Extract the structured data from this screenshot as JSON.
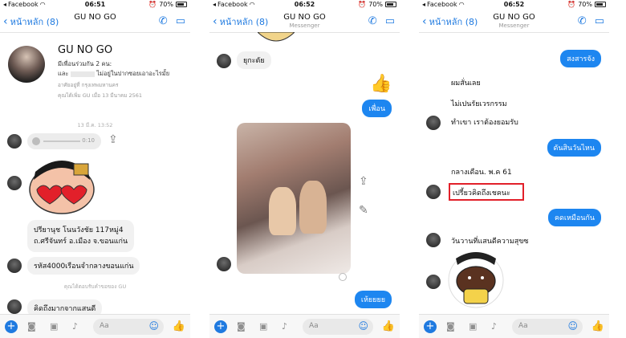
{
  "status": {
    "carrier": "Facebook",
    "battery": "70%",
    "times": [
      "06:51",
      "06:52",
      "06:52"
    ]
  },
  "nav": {
    "back_label": "หน้าหลัก (8)",
    "title": "GU NO GO",
    "subtitle": "Messenger"
  },
  "icons": {
    "phone": "phone-icon",
    "video": "video-camera-icon",
    "camera": "camera-icon",
    "photo": "photo-icon",
    "mic": "microphone-icon",
    "smile": "emoji-icon",
    "like": "thumbs-up-icon",
    "share": "share-icon",
    "edit": "edit-pencil-icon",
    "plus": "plus-icon"
  },
  "colors": {
    "accent": "#1f7ae0",
    "bubble_blue": "#1d86f0",
    "highlight_red": "#e2202a"
  },
  "composer": {
    "placeholder": "Aa"
  },
  "panel1": {
    "profile_name": "GU NO GO",
    "friends_line": "มีเพื่อนร่วมกัน 2 คน:",
    "mutual_line": "และ",
    "mutual_line_b": "ไม่อยู่ในปากซอยเอาอะไรมั้ย",
    "location": "อาศัยอยู่ที่ กรุงเทพมหานคร",
    "added_info": "คุณได้เพิ่ม GU เมื่อ 13 มีนาคม 2561",
    "timestamp": "13 มี.ค. 13:52",
    "audio_duration": "0:10",
    "address_line1": "ปรียานุช  โนนวังชัย 117หมู่4",
    "address_line2": "ถ.ศรีจันทร์ อ.เมือง จ.ขอนแก่น",
    "code_line": "รหัส4000เรือนจำกลางขอนแก่น",
    "system_note": "คุณได้ตอบรับคำขอของ GU",
    "last_message": "คิดถึงมากจากแสนดี"
  },
  "panel2": {
    "msg1": "ยุกะตัย",
    "reply1": "เพื่อน",
    "reply2": "เห้ยยยย"
  },
  "panel3": {
    "blue1": "สงสารจัง",
    "gray1": "ผมสั่นเลย",
    "gray2": "ไม่เปนรัยเวรกรรม",
    "gray3": "ทำเขา เราต้องยอมรับ",
    "blue2": "ดันสินวันไหน",
    "gray4": "กลางเดือน. พ.ค 61",
    "gray5": "เปรี้ยวคิดถึงเชคนะ",
    "blue3": "คดเหมือนกัน",
    "gray6": "วันวานที่แสนดีความสุขซ"
  }
}
